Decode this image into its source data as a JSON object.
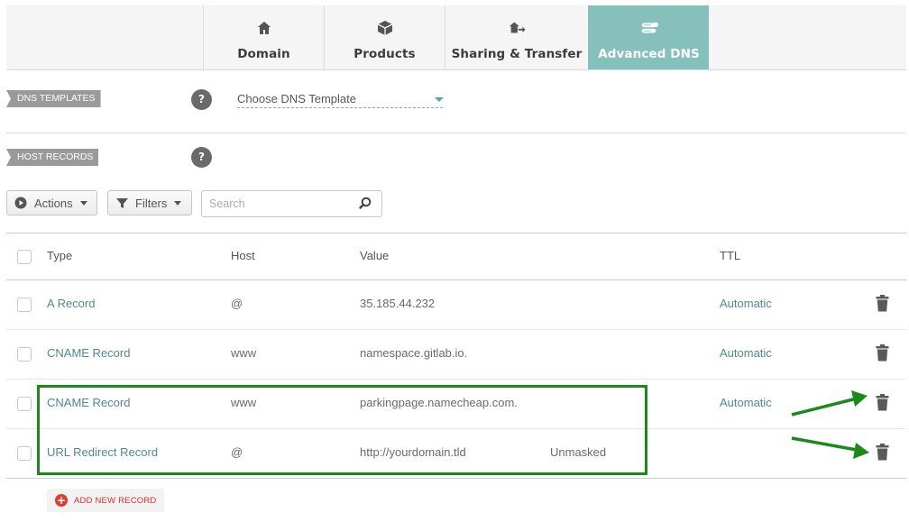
{
  "tabs": [
    {
      "label": "Domain",
      "icon": "home-icon"
    },
    {
      "label": "Products",
      "icon": "box-icon"
    },
    {
      "label": "Sharing & Transfer",
      "icon": "transfer-icon"
    },
    {
      "label": "Advanced DNS",
      "icon": "server-icon",
      "active": true
    }
  ],
  "dns_templates": {
    "tag": "DNS TEMPLATES",
    "help": "?",
    "select_value": "Choose DNS Template"
  },
  "host_records": {
    "tag": "HOST RECORDS",
    "help": "?"
  },
  "toolbar": {
    "actions_label": "Actions",
    "filters_label": "Filters",
    "search_placeholder": "Search"
  },
  "table": {
    "headers": {
      "type": "Type",
      "host": "Host",
      "value": "Value",
      "ttl": "TTL"
    },
    "rows": [
      {
        "type": "A Record",
        "host": "@",
        "value": "35.185.44.232",
        "extra": "",
        "ttl": "Automatic"
      },
      {
        "type": "CNAME Record",
        "host": "www",
        "value": "namespace.gitlab.io.",
        "extra": "",
        "ttl": "Automatic"
      },
      {
        "type": "CNAME Record",
        "host": "www",
        "value": "parkingpage.namecheap.com.",
        "extra": "",
        "ttl": "Automatic"
      },
      {
        "type": "URL Redirect Record",
        "host": "@",
        "value": "http://yourdomain.tld",
        "extra": "Unmasked",
        "ttl": ""
      }
    ]
  },
  "add_record_label": "ADD NEW RECORD",
  "colors": {
    "accent": "#86c0bd",
    "record_text": "#4f8a8b",
    "highlight": "#1a8a1a",
    "add_red": "#e03c31"
  }
}
